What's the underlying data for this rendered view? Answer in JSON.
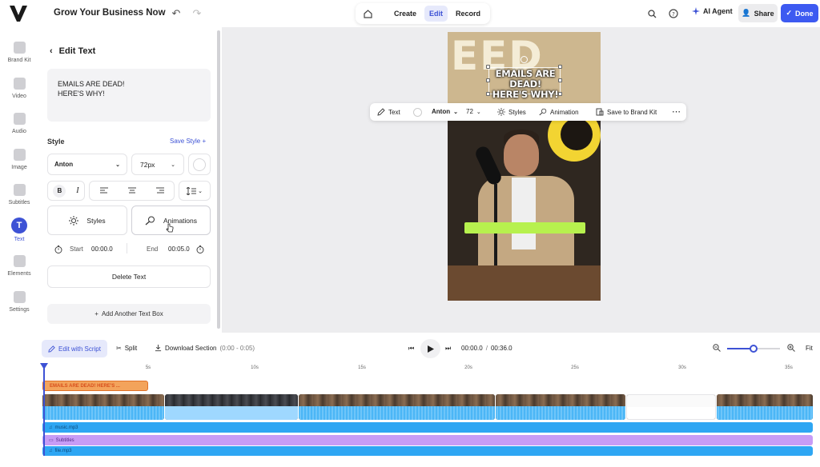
{
  "topbar": {
    "project_title": "Grow Your Business Now",
    "modes": [
      "Create",
      "Edit",
      "Record"
    ],
    "active_mode": "Edit",
    "ai_agent": "AI Agent",
    "share": "Share",
    "done": "Done",
    "accent": "#3d52d5"
  },
  "rail": {
    "items": [
      {
        "label": "Brand Kit",
        "icon": "brand-kit-icon"
      },
      {
        "label": "Video",
        "icon": "video-icon"
      },
      {
        "label": "Audio",
        "icon": "audio-icon"
      },
      {
        "label": "Image",
        "icon": "image-icon"
      },
      {
        "label": "Subtitles",
        "icon": "subtitles-icon"
      },
      {
        "label": "Text",
        "icon": "text-icon",
        "glyph": "T"
      },
      {
        "label": "Elements",
        "icon": "elements-icon"
      },
      {
        "label": "Settings",
        "icon": "settings-icon"
      }
    ],
    "active": "Text"
  },
  "panel": {
    "title": "Edit Text",
    "text_line1": "EMAILS ARE DEAD!",
    "text_line2": "HERE'S WHY!",
    "style_label": "Style",
    "save_style": "Save Style +",
    "font": "Anton",
    "size": "72px",
    "bold": "B",
    "italic": "I",
    "styles_btn": "Styles",
    "animations_btn": "Animations",
    "start_label": "Start",
    "start_value": "00:00.0",
    "end_label": "End",
    "end_value": "00:05.0",
    "delete": "Delete Text",
    "add_box": "Add Another Text Box"
  },
  "canvas": {
    "caption_line1": "EMAILS ARE DEAD!",
    "caption_line2": "HERE'S WHY!",
    "bg_letters": "EED",
    "highlight_color": "#b7f14e"
  },
  "float_toolbar": {
    "text": "Text",
    "font": "Anton",
    "size": "72",
    "styles": "Styles",
    "animation": "Animation",
    "save_brand": "Save to Brand Kit"
  },
  "timeline": {
    "edit_script": "Edit with Script",
    "split": "Split",
    "download": "Download Section",
    "download_range": "(0:00 - 0:05)",
    "current_time": "00:00.0",
    "separator": "/",
    "total_time": "00:36.0",
    "fit": "Fit",
    "zoom_level": 0.5,
    "ruler": [
      "5s",
      "10s",
      "15s",
      "20s",
      "25s",
      "30s",
      "35s"
    ],
    "text_clip": "EMAILS ARE DEAD! HERE'S ...",
    "music_track": "music.mp3",
    "subtitles_track": "Subtitles",
    "vo_track": "file.mp3"
  }
}
